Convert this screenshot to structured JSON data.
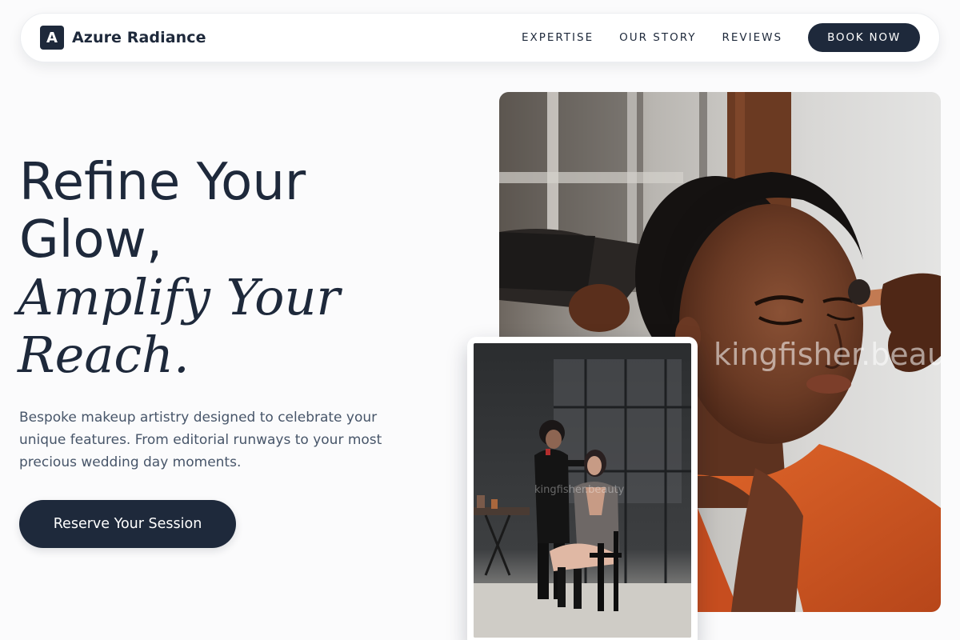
{
  "brand": {
    "logo_letter": "A",
    "name": "Azure Radiance"
  },
  "nav": {
    "links": [
      "EXPERTISE",
      "OUR STORY",
      "REVIEWS"
    ],
    "book_label": "BOOK NOW"
  },
  "hero": {
    "title_line1": "Refine Your",
    "title_line2": "Glow,",
    "title_italic_line1": "Amplify Your",
    "title_italic_line2": "Reach.",
    "description": "Bespoke makeup artistry designed to celebrate your unique features. From editorial runways to your most precious wedding day moments.",
    "cta_label": "Reserve Your Session"
  },
  "images": {
    "main_watermark": "kingfisher.beauty",
    "inset_watermark": "kingfisher.beauty"
  },
  "colors": {
    "primary": "#1e293b",
    "background": "#fbfbfc",
    "text_muted": "#475569",
    "accent_orange": "#d2541e"
  }
}
